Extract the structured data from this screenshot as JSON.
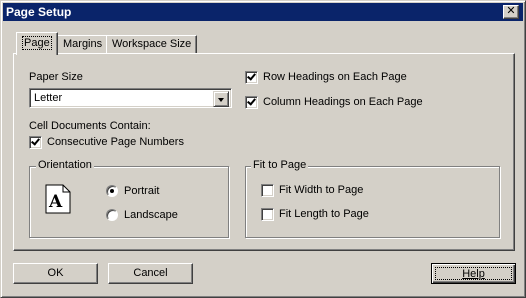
{
  "window": {
    "title": "Page Setup"
  },
  "tabs": [
    {
      "label": "Page",
      "active": true
    },
    {
      "label": "Margins",
      "active": false
    },
    {
      "label": "Workspace Size",
      "active": false
    }
  ],
  "paper_size": {
    "label": "Paper Size",
    "value": "Letter"
  },
  "headings": {
    "row": {
      "label": "Row Headings on Each Page",
      "checked": true
    },
    "column": {
      "label": "Column Headings on Each Page",
      "checked": true
    }
  },
  "cell_documents": {
    "label": "Cell Documents Contain:",
    "consecutive": {
      "label": "Consecutive Page Numbers",
      "checked": true
    }
  },
  "orientation": {
    "title": "Orientation",
    "icon_letter": "A",
    "portrait": {
      "label": "Portrait",
      "selected": true
    },
    "landscape": {
      "label": "Landscape",
      "selected": false
    }
  },
  "fit_to_page": {
    "title": "Fit to Page",
    "width": {
      "label": "Fit Width to Page",
      "checked": false
    },
    "length": {
      "label": "Fit Length to Page",
      "checked": false
    }
  },
  "buttons": {
    "ok": "OK",
    "cancel": "Cancel",
    "help": "Help"
  },
  "close_glyph": "✕"
}
